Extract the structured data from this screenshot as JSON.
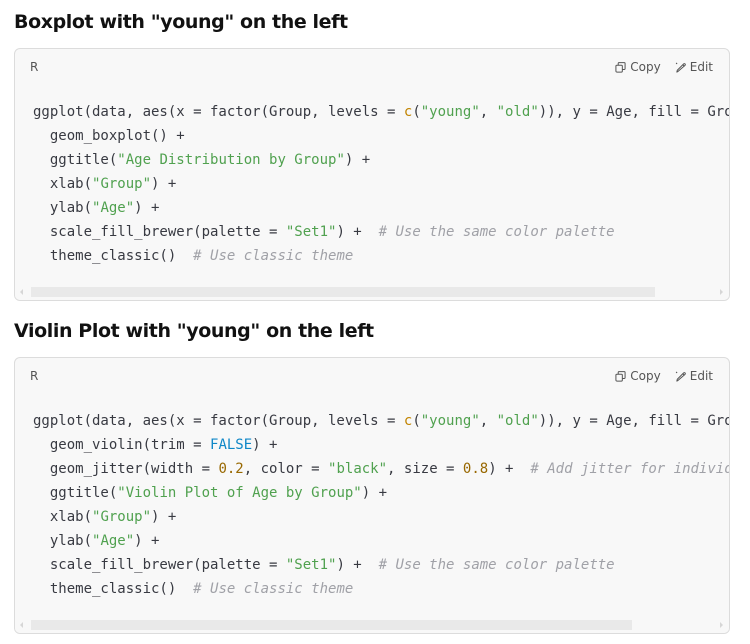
{
  "sections": [
    {
      "heading": "Boxplot with \"young\" on the left",
      "codeblock": {
        "language": "R",
        "copy_label": "Copy",
        "edit_label": "Edit",
        "lines": [
          [
            {
              "t": "plain",
              "v": "ggplot(data, aes(x = factor(Group, levels = "
            },
            {
              "t": "fn",
              "v": "c"
            },
            {
              "t": "plain",
              "v": "("
            },
            {
              "t": "str",
              "v": "\"young\""
            },
            {
              "t": "plain",
              "v": ", "
            },
            {
              "t": "str",
              "v": "\"old\""
            },
            {
              "t": "plain",
              "v": ")), y = Age, fill = Group)) +"
            }
          ],
          [
            {
              "t": "plain",
              "v": "  geom_boxplot() +"
            }
          ],
          [
            {
              "t": "plain",
              "v": "  ggtitle("
            },
            {
              "t": "str",
              "v": "\"Age Distribution by Group\""
            },
            {
              "t": "plain",
              "v": ") +"
            }
          ],
          [
            {
              "t": "plain",
              "v": "  xlab("
            },
            {
              "t": "str",
              "v": "\"Group\""
            },
            {
              "t": "plain",
              "v": ") +"
            }
          ],
          [
            {
              "t": "plain",
              "v": "  ylab("
            },
            {
              "t": "str",
              "v": "\"Age\""
            },
            {
              "t": "plain",
              "v": ") +"
            }
          ],
          [
            {
              "t": "plain",
              "v": "  scale_fill_brewer(palette = "
            },
            {
              "t": "str",
              "v": "\"Set1\""
            },
            {
              "t": "plain",
              "v": ") +  "
            },
            {
              "t": "com",
              "v": "# Use the same color palette"
            }
          ],
          [
            {
              "t": "plain",
              "v": "  theme_classic()  "
            },
            {
              "t": "com",
              "v": "# Use classic theme"
            }
          ]
        ]
      }
    },
    {
      "heading": "Violin Plot with \"young\" on the left",
      "codeblock": {
        "language": "R",
        "copy_label": "Copy",
        "edit_label": "Edit",
        "lines": [
          [
            {
              "t": "plain",
              "v": "ggplot(data, aes(x = factor(Group, levels = "
            },
            {
              "t": "fn",
              "v": "c"
            },
            {
              "t": "plain",
              "v": "("
            },
            {
              "t": "str",
              "v": "\"young\""
            },
            {
              "t": "plain",
              "v": ", "
            },
            {
              "t": "str",
              "v": "\"old\""
            },
            {
              "t": "plain",
              "v": ")), y = Age, fill = Group)) +"
            }
          ],
          [
            {
              "t": "plain",
              "v": "  geom_violin(trim = "
            },
            {
              "t": "kw",
              "v": "FALSE"
            },
            {
              "t": "plain",
              "v": ") +"
            }
          ],
          [
            {
              "t": "plain",
              "v": "  geom_jitter(width = "
            },
            {
              "t": "num",
              "v": "0.2"
            },
            {
              "t": "plain",
              "v": ", color = "
            },
            {
              "t": "str",
              "v": "\"black\""
            },
            {
              "t": "plain",
              "v": ", size = "
            },
            {
              "t": "num",
              "v": "0.8"
            },
            {
              "t": "plain",
              "v": ") +  "
            },
            {
              "t": "com",
              "v": "# Add jitter for individ"
            }
          ],
          [
            {
              "t": "plain",
              "v": "  ggtitle("
            },
            {
              "t": "str",
              "v": "\"Violin Plot of Age by Group\""
            },
            {
              "t": "plain",
              "v": ") +"
            }
          ],
          [
            {
              "t": "plain",
              "v": "  xlab("
            },
            {
              "t": "str",
              "v": "\"Group\""
            },
            {
              "t": "plain",
              "v": ") +"
            }
          ],
          [
            {
              "t": "plain",
              "v": "  ylab("
            },
            {
              "t": "str",
              "v": "\"Age\""
            },
            {
              "t": "plain",
              "v": ") +"
            }
          ],
          [
            {
              "t": "plain",
              "v": "  scale_fill_brewer(palette = "
            },
            {
              "t": "str",
              "v": "\"Set1\""
            },
            {
              "t": "plain",
              "v": ") +  "
            },
            {
              "t": "com",
              "v": "# Use the same color palette"
            }
          ],
          [
            {
              "t": "plain",
              "v": "  theme_classic()  "
            },
            {
              "t": "com",
              "v": "# Use classic theme"
            }
          ]
        ]
      }
    }
  ],
  "icons": {
    "copy": "copy-icon",
    "edit": "edit-icon"
  },
  "colors": {
    "string": "#50a14f",
    "function": "#c18401",
    "number": "#986801",
    "keyword": "#0f87c7",
    "comment": "#a0a1a7",
    "code_bg": "#f8f8f8"
  }
}
